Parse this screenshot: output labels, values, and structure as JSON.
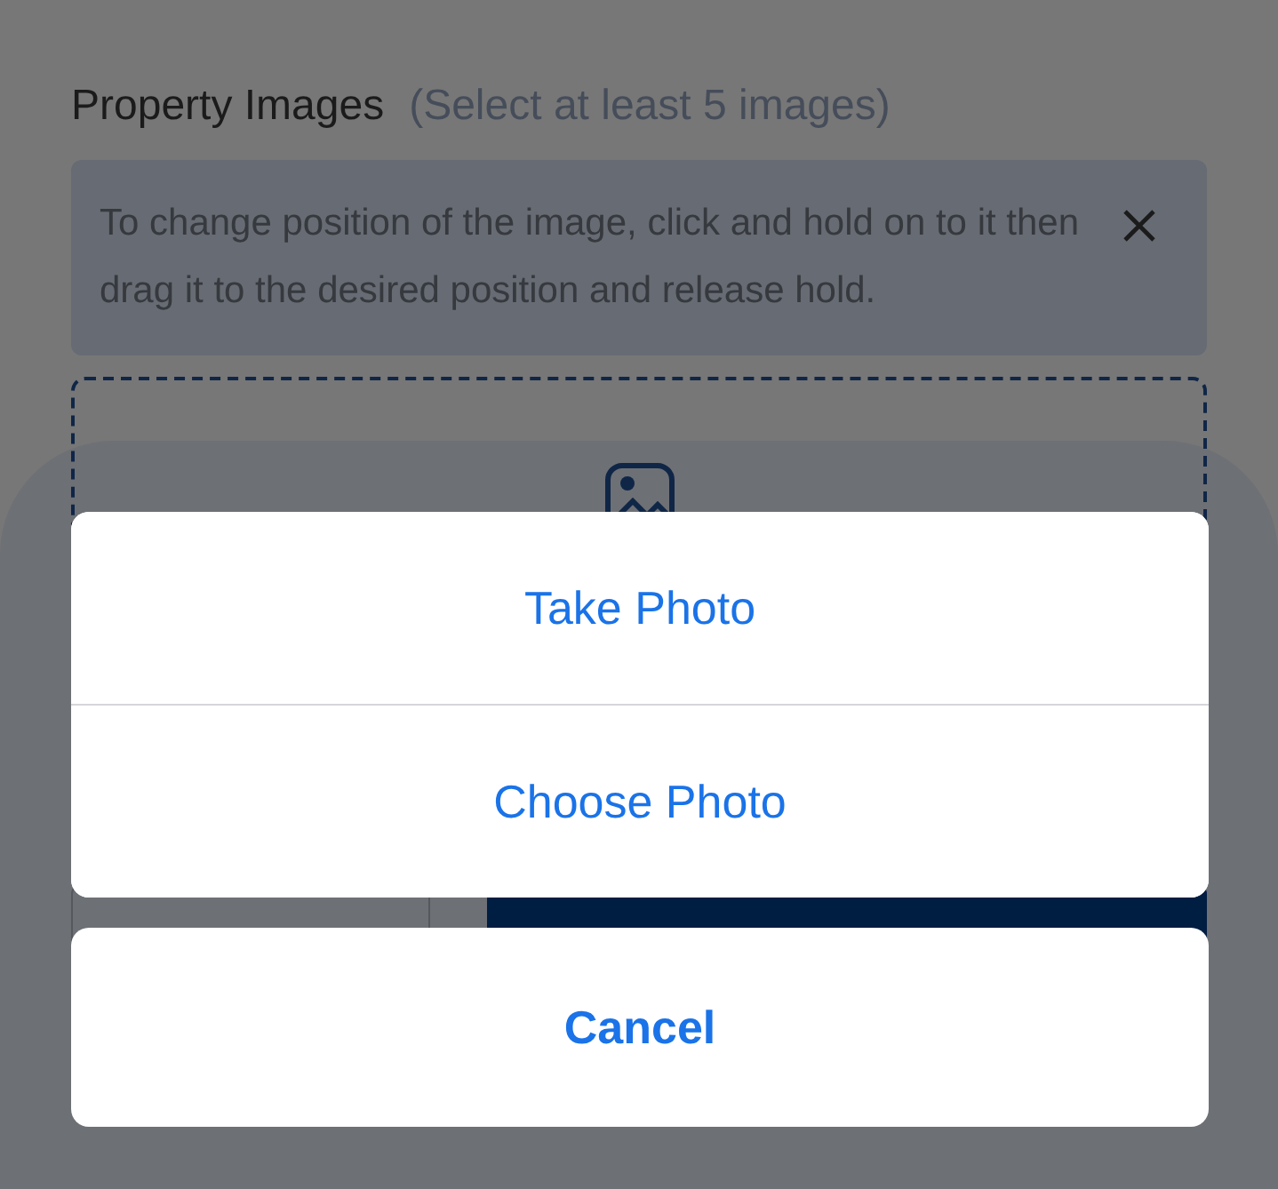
{
  "page": {
    "title": "Property Images",
    "subtitle": "(Select at least 5 images)",
    "notice": {
      "text": "To change position of the image, click and hold on to it then drag it to the desired position and release hold."
    }
  },
  "action_sheet": {
    "options": [
      {
        "label": "Take Photo"
      },
      {
        "label": "Choose Photo"
      }
    ],
    "cancel": "Cancel"
  }
}
